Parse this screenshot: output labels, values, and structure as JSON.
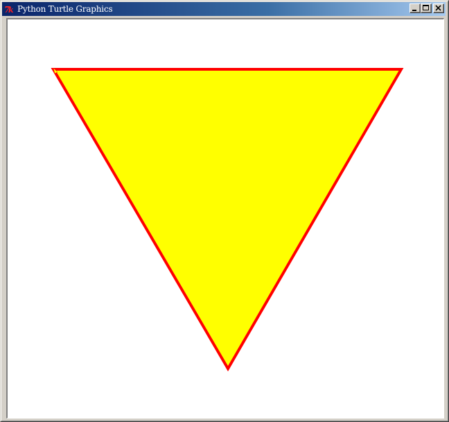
{
  "window": {
    "title": "Python Turtle Graphics",
    "app_icon": "tk-logo-icon",
    "buttons": {
      "minimize": "minimize-icon",
      "maximize": "maximize-icon",
      "close": "close-icon"
    }
  },
  "drawing": {
    "shape": "triangle",
    "fill_color": "#ffff00",
    "pen_color": "#ff0000"
  }
}
